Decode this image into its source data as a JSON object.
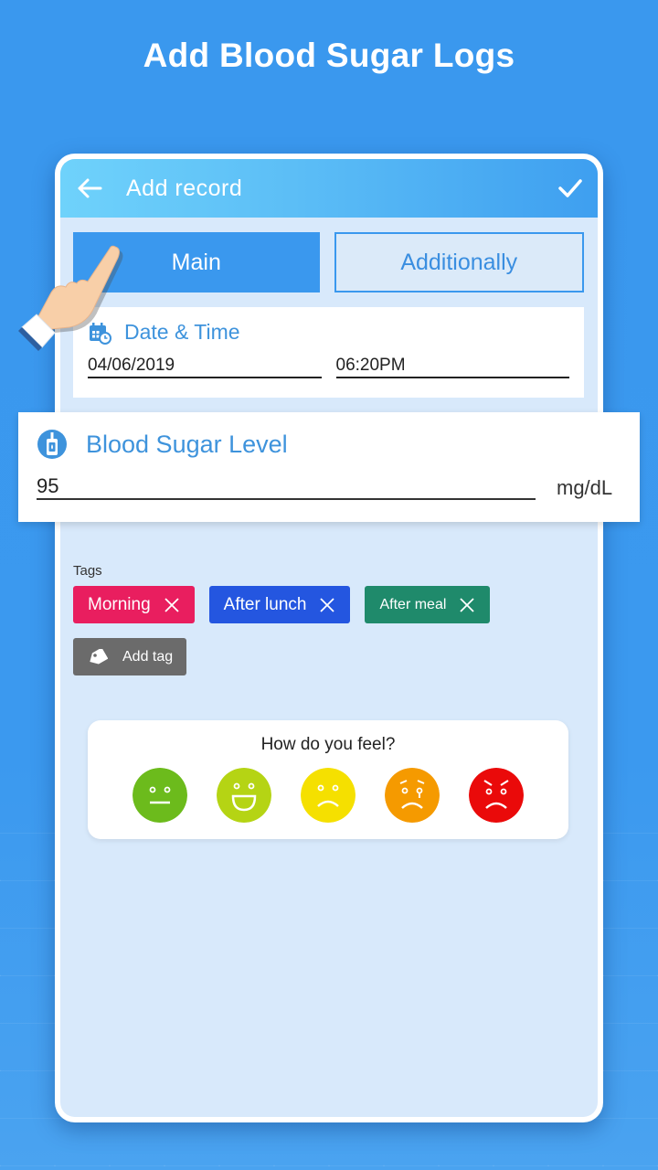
{
  "headline": "Add Blood Sugar Logs",
  "appbar": {
    "title": "Add  record",
    "back_icon": "arrow-left-icon",
    "confirm_icon": "check-icon"
  },
  "tabs": [
    {
      "label": "Main",
      "active": true
    },
    {
      "label": "Additionally",
      "active": false
    }
  ],
  "date_time": {
    "title": "Date & Time",
    "icon": "calendar-clock-icon",
    "date": "04/06/2019",
    "time": "06:20PM"
  },
  "blood_sugar": {
    "title": "Blood Sugar Level",
    "icon": "glucometer-icon",
    "value": "95",
    "unit": "mg/dL"
  },
  "tags": {
    "label": "Tags",
    "items": [
      {
        "label": "Morning",
        "color": "#e91e5f"
      },
      {
        "label": "After lunch",
        "color": "#2456e0"
      },
      {
        "label": "After meal",
        "color": "#1f8a6b"
      }
    ],
    "add_label": "Add tag"
  },
  "feel": {
    "title": "How do you feel?",
    "options": [
      {
        "mood": "neutral",
        "color": "#6cbb1c"
      },
      {
        "mood": "happy",
        "color": "#b5d414"
      },
      {
        "mood": "sad",
        "color": "#f5e000"
      },
      {
        "mood": "crying",
        "color": "#f59a00"
      },
      {
        "mood": "angry",
        "color": "#ea0a0a"
      }
    ]
  },
  "colors": {
    "accent": "#3a98ee",
    "section_title": "#3e93dc",
    "screen_bg": "#d8e9fb"
  }
}
